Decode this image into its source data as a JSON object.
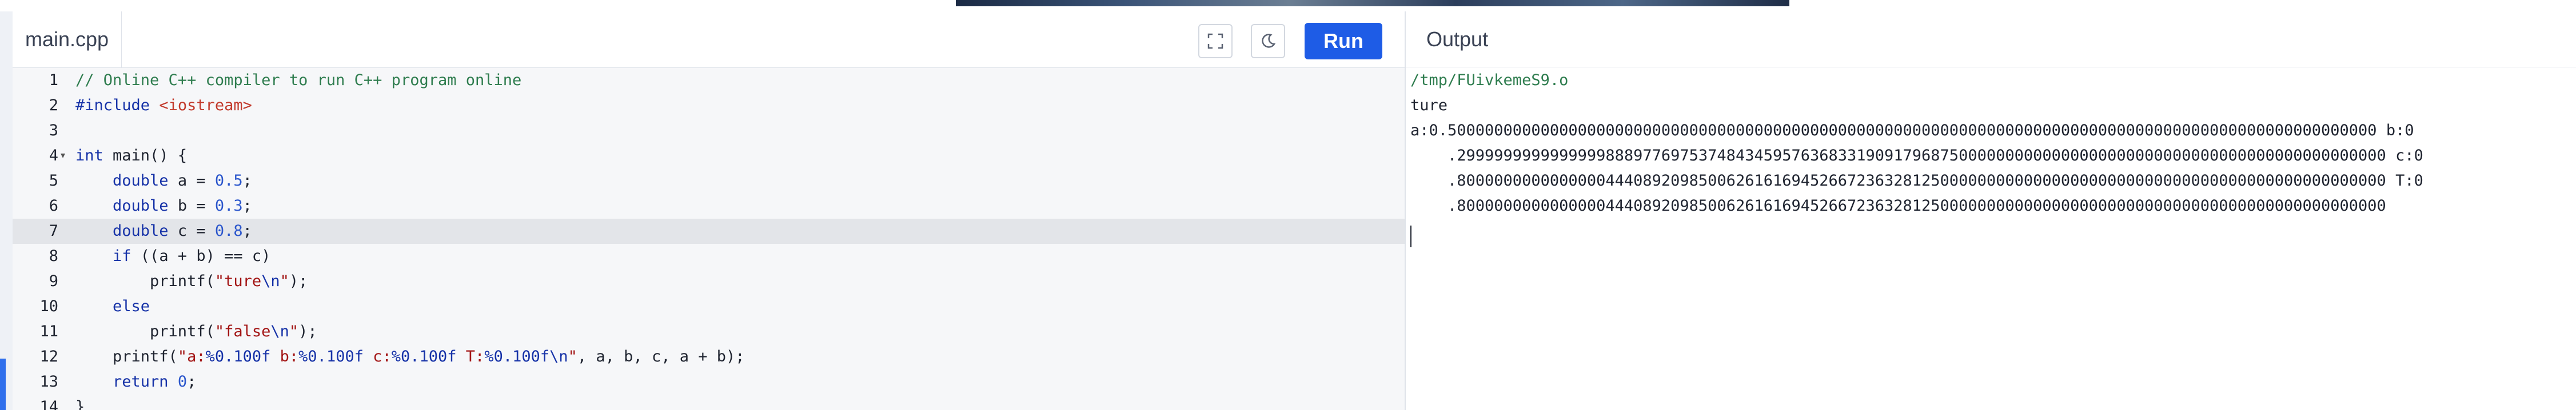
{
  "editor": {
    "file_tab": "main.cpp",
    "run_label": "Run",
    "fullscreen_icon": "fullscreen-icon",
    "theme_icon": "moon-icon",
    "line_numbers": [
      "1",
      "2",
      "3",
      "4",
      "5",
      "6",
      "7",
      "8",
      "9",
      "10",
      "11",
      "12",
      "13",
      "14"
    ],
    "lines": [
      "// Online C++ compiler to run C++ program online",
      "#include <iostream>",
      "",
      "int main() {",
      "    double a = 0.5;",
      "    double b = 0.3;",
      "    double c = 0.8;",
      "    if ((a + b) == c)",
      "        printf(\"ture\\n\");",
      "    else",
      "        printf(\"false\\n\");",
      "    printf(\"a:%0.100f b:%0.100f c:%0.100f T:%0.100f\\n\", a, b, c, a + b);",
      "    return 0;",
      "}"
    ]
  },
  "output": {
    "header": "Output",
    "lines": [
      "/tmp/FUivkemeS9.o",
      "ture",
      "a:0.5000000000000000000000000000000000000000000000000000000000000000000000000000000000000000000000000000 b:0",
      "    .2999999999999999888977697537484345957636833190917968750000000000000000000000000000000000000000000000 c:0",
      "    .8000000000000000444089209850062616169452667236328125000000000000000000000000000000000000000000000000 T:0",
      "    .8000000000000000444089209850062616169452667236328125000000000000000000000000000000000000000000000000"
    ]
  }
}
